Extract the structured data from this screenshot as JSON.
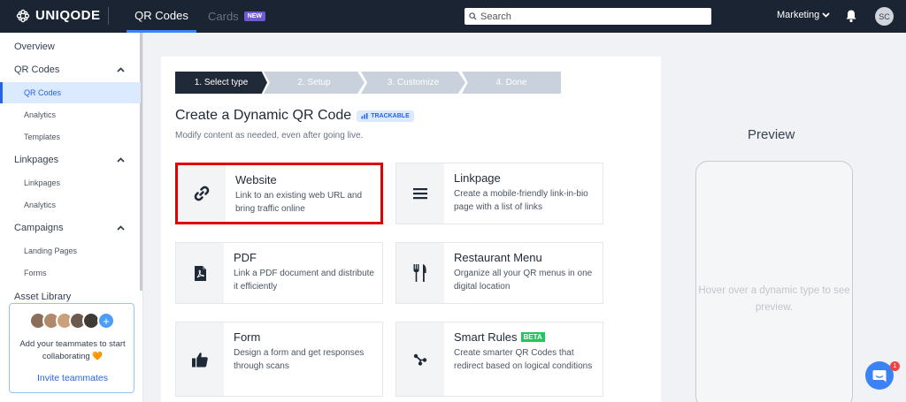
{
  "brand": {
    "name": "UNIQODE"
  },
  "topbar": {
    "tab_qr": "QR Codes",
    "tab_cards": "Cards",
    "cards_badge": "NEW",
    "search_placeholder": "Search",
    "workspace": "Marketing",
    "avatar_initials": "SC"
  },
  "sidebar": {
    "overview": "Overview",
    "qr_group": "QR Codes",
    "qr_items": [
      "QR Codes",
      "Analytics",
      "Templates"
    ],
    "linkpages_group": "Linkpages",
    "linkpages_items": [
      "Linkpages",
      "Analytics"
    ],
    "campaigns_group": "Campaigns",
    "campaigns_items": [
      "Landing Pages",
      "Forms"
    ],
    "asset_library": "Asset Library",
    "invite": {
      "text": "Add your teammates to start collaborating 🧡",
      "link": "Invite teammates"
    }
  },
  "steps": [
    "1. Select type",
    "2. Setup",
    "3. Customize",
    "4. Done"
  ],
  "main": {
    "title": "Create a Dynamic QR Code",
    "trackable_badge": "TRACKABLE",
    "subtitle": "Modify content as needed, even after going live."
  },
  "types": [
    {
      "title": "Website",
      "desc": "Link to an existing web URL and bring traffic online",
      "icon": "link-icon"
    },
    {
      "title": "Linkpage",
      "desc": "Create a mobile-friendly link-in-bio page with a list of links",
      "icon": "list-icon"
    },
    {
      "title": "PDF",
      "desc": "Link a PDF document and distribute it efficiently",
      "icon": "pdf-icon"
    },
    {
      "title": "Restaurant Menu",
      "desc": "Organize all your QR menus in one digital location",
      "icon": "utensils-icon"
    },
    {
      "title": "Form",
      "desc": "Design a form and get responses through scans",
      "icon": "thumbs-up-icon"
    },
    {
      "title": "Smart Rules",
      "badge": "BETA",
      "desc": "Create smarter QR Codes that redirect based on logical conditions",
      "icon": "rules-icon"
    }
  ],
  "preview": {
    "title": "Preview",
    "hint": "Hover over a dynamic type to see preview."
  },
  "chat": {
    "badge": "1"
  },
  "colors": {
    "topbar": "#1b2433",
    "accent": "#2563eb",
    "selected_border": "#e00000",
    "beta": "#22c55e"
  }
}
